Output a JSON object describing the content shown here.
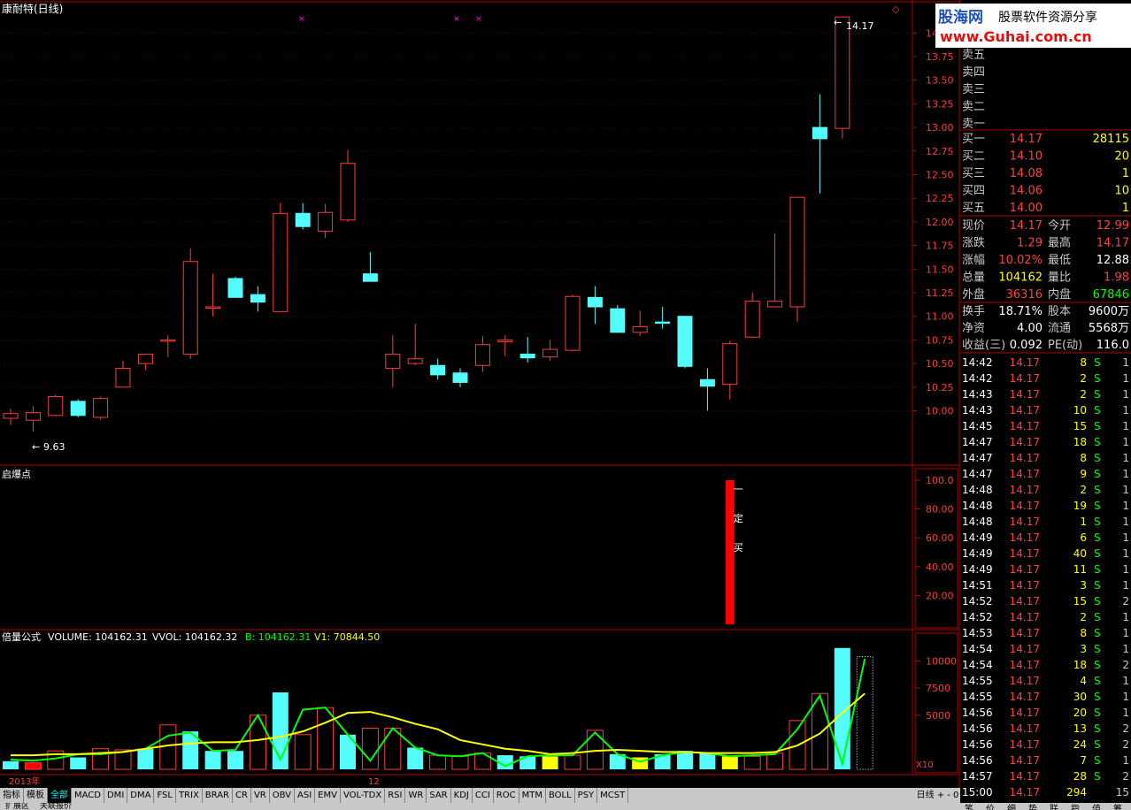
{
  "title": "康耐特(日线)",
  "top_icon": "◇",
  "watermark": {
    "line1": "股海网",
    "line2": "股票软件资源分享",
    "line3": "www.Guhai.com.cn"
  },
  "price_chart": {
    "high_label": "14.17",
    "low_label": "9.63",
    "y_ticks": [
      "10.00",
      "10.25",
      "10.50",
      "10.75",
      "11.00",
      "11.25",
      "11.50",
      "11.75",
      "12.00",
      "12.25",
      "12.50",
      "12.75",
      "13.00",
      "13.25",
      "13.50",
      "13.75",
      "14.00"
    ],
    "candles": [
      {
        "o": 9.92,
        "c": 9.97,
        "h": 10.02,
        "l": 9.85
      },
      {
        "o": 9.9,
        "c": 9.98,
        "h": 10.05,
        "l": 9.78
      },
      {
        "o": 9.95,
        "c": 10.15,
        "h": 10.17,
        "l": 9.94
      },
      {
        "o": 10.1,
        "c": 9.95,
        "h": 10.12,
        "l": 9.93
      },
      {
        "o": 9.93,
        "c": 10.13,
        "h": 10.15,
        "l": 9.91
      },
      {
        "o": 10.25,
        "c": 10.45,
        "h": 10.53,
        "l": 10.25
      },
      {
        "o": 10.5,
        "c": 10.6,
        "h": 10.6,
        "l": 10.43
      },
      {
        "o": 10.75,
        "c": 10.75,
        "h": 10.8,
        "l": 10.57
      },
      {
        "o": 10.6,
        "c": 11.58,
        "h": 11.72,
        "l": 10.55
      },
      {
        "o": 11.1,
        "c": 11.1,
        "h": 11.45,
        "l": 11.0
      },
      {
        "o": 11.4,
        "c": 11.2,
        "h": 11.42,
        "l": 11.2
      },
      {
        "o": 11.23,
        "c": 11.15,
        "h": 11.32,
        "l": 11.05
      },
      {
        "o": 11.05,
        "c": 12.09,
        "h": 12.2,
        "l": 11.05
      },
      {
        "o": 12.09,
        "c": 11.95,
        "h": 12.2,
        "l": 11.92
      },
      {
        "o": 11.9,
        "c": 12.1,
        "h": 12.19,
        "l": 11.83
      },
      {
        "o": 12.02,
        "c": 12.62,
        "h": 12.76,
        "l": 12.0
      },
      {
        "o": 11.45,
        "c": 11.37,
        "h": 11.68,
        "l": 11.37
      },
      {
        "o": 10.45,
        "c": 10.6,
        "h": 10.8,
        "l": 10.25
      },
      {
        "o": 10.5,
        "c": 10.55,
        "h": 10.92,
        "l": 10.48
      },
      {
        "o": 10.48,
        "c": 10.38,
        "h": 10.55,
        "l": 10.33
      },
      {
        "o": 10.4,
        "c": 10.3,
        "h": 10.45,
        "l": 10.25
      },
      {
        "o": 10.48,
        "c": 10.7,
        "h": 10.79,
        "l": 10.41
      },
      {
        "o": 10.73,
        "c": 10.75,
        "h": 10.8,
        "l": 10.58
      },
      {
        "o": 10.6,
        "c": 10.56,
        "h": 10.78,
        "l": 10.51
      },
      {
        "o": 10.57,
        "c": 10.65,
        "h": 10.75,
        "l": 10.53
      },
      {
        "o": 10.64,
        "c": 11.21,
        "h": 11.23,
        "l": 10.63
      },
      {
        "o": 11.2,
        "c": 11.1,
        "h": 11.32,
        "l": 10.92
      },
      {
        "o": 11.08,
        "c": 10.83,
        "h": 11.12,
        "l": 10.83
      },
      {
        "o": 10.83,
        "c": 10.89,
        "h": 11.06,
        "l": 10.79
      },
      {
        "o": 10.94,
        "c": 10.93,
        "h": 11.1,
        "l": 10.87
      },
      {
        "o": 11.0,
        "c": 10.47,
        "h": 11.0,
        "l": 10.45
      },
      {
        "o": 10.33,
        "c": 10.26,
        "h": 10.45,
        "l": 10.0
      },
      {
        "o": 10.28,
        "c": 10.71,
        "h": 10.74,
        "l": 10.12
      },
      {
        "o": 10.78,
        "c": 11.16,
        "h": 11.25,
        "l": 10.77
      },
      {
        "o": 11.1,
        "c": 11.16,
        "h": 11.88,
        "l": 11.1
      },
      {
        "o": 11.1,
        "c": 12.26,
        "h": 12.26,
        "l": 10.94
      },
      {
        "o": 13.0,
        "c": 12.88,
        "h": 13.35,
        "l": 12.3
      },
      {
        "o": 12.99,
        "c": 14.17,
        "h": 14.17,
        "l": 12.88
      }
    ]
  },
  "indicator": {
    "label": "启爆点",
    "y_ticks": [
      "20.00",
      "40.00",
      "60.00",
      "80.00",
      "100.0"
    ],
    "signal_text": [
      "一",
      "定",
      "买"
    ],
    "signal_value": 100
  },
  "volume": {
    "formula_name": "倍量公式",
    "volume_text": "VOLUME: 104162.31",
    "vvol_text": "VVOL: 104162.32",
    "b_text": "B: 104162.31",
    "v1_text": "V1: 70844.50",
    "y_ticks": [
      "5000",
      "7500",
      "10000"
    ],
    "x10": "X10",
    "bars": [
      750,
      600,
      1700,
      1100,
      1900,
      1800,
      1900,
      4100,
      3500,
      1700,
      1700,
      5000,
      7100,
      3200,
      5700,
      3200,
      3800,
      3800,
      2000,
      1300,
      1200,
      1500,
      1300,
      1200,
      1200,
      1300,
      3600,
      1400,
      1100,
      1400,
      1700,
      1500,
      1200,
      1200,
      1500,
      4500,
      7000,
      11200,
      10400
    ],
    "bar_types": [
      "c",
      "r",
      "r",
      "c",
      "r",
      "r",
      "c",
      "r",
      "c",
      "c",
      "c",
      "r",
      "c",
      "r",
      "r",
      "c",
      "r",
      "r",
      "c",
      "r",
      "r",
      "r",
      "c",
      "c",
      "y",
      "r",
      "r",
      "c",
      "y",
      "c",
      "c",
      "c",
      "y",
      "r",
      "r",
      "r",
      "r",
      "c",
      "d"
    ],
    "ma_yellow": [
      1300,
      1300,
      1400,
      1400,
      1500,
      1600,
      1900,
      2200,
      2400,
      2500,
      2500,
      2700,
      3000,
      3500,
      4300,
      5200,
      5300,
      4800,
      4200,
      3700,
      2700,
      2300,
      1900,
      1700,
      1400,
      1500,
      1700,
      1800,
      1700,
      1600,
      1600,
      1500,
      1500,
      1500,
      1600,
      2200,
      3300,
      5200,
      7000
    ],
    "ma_green": [
      900,
      800,
      1000,
      1400,
      1400,
      1600,
      1900,
      3100,
      3400,
      1700,
      1800,
      5000,
      900,
      5500,
      5700,
      3200,
      800,
      3800,
      2000,
      1300,
      1200,
      1500,
      300,
      1200,
      1300,
      1300,
      3400,
      1400,
      700,
      1300,
      1600,
      1500,
      1200,
      1300,
      1400,
      3700,
      6800,
      500,
      10200
    ]
  },
  "x_labels": {
    "label1": "2013年",
    "label2": "12"
  },
  "toolbar": {
    "tabs": [
      "指标",
      "模板",
      "全部",
      "MACD",
      "DMI",
      "DMA",
      "FSL",
      "TRIX",
      "BRAR",
      "CR",
      "VR",
      "OBV",
      "ASI",
      "EMV",
      "VOL-TDX",
      "RSI",
      "WR",
      "SAR",
      "KDJ",
      "CCI",
      "ROC",
      "MTM",
      "BOLL",
      "PSY",
      "MCST"
    ],
    "bottom_tabs": [
      "扩展区",
      "关联报价"
    ],
    "right_label": "日线",
    "right_buttons": [
      "+",
      "-",
      "0"
    ]
  },
  "quote": {
    "asks": [
      "卖五",
      "卖四",
      "卖三",
      "卖二",
      "卖一"
    ],
    "bids": [
      {
        "label": "买一",
        "price": "14.17",
        "vol": "28115"
      },
      {
        "label": "买二",
        "price": "14.10",
        "vol": "20"
      },
      {
        "label": "买三",
        "price": "14.08",
        "vol": "1"
      },
      {
        "label": "买四",
        "price": "14.06",
        "vol": "10"
      },
      {
        "label": "买五",
        "price": "14.00",
        "vol": "1"
      }
    ],
    "stats": [
      {
        "l1": "现价",
        "v1": "14.17",
        "l2": "今开",
        "v2": "12.99",
        "c1": "#ff4040",
        "c2": "#ff4040"
      },
      {
        "l1": "涨跌",
        "v1": "1.29",
        "l2": "最高",
        "v2": "14.17",
        "c1": "#ff4040",
        "c2": "#ff4040"
      },
      {
        "l1": "涨幅",
        "v1": "10.02%",
        "l2": "最低",
        "v2": "12.88",
        "c1": "#ff4040",
        "c2": "#ffffff"
      },
      {
        "l1": "总量",
        "v1": "104162",
        "l2": "量比",
        "v2": "1.98",
        "c1": "#ffff00",
        "c2": "#ff4040"
      },
      {
        "l1": "外盘",
        "v1": "36316",
        "l2": "内盘",
        "v2": "67846",
        "c1": "#ff4040",
        "c2": "#00ff00"
      }
    ],
    "stats2": [
      {
        "l1": "换手",
        "v1": "18.71%",
        "l2": "股本",
        "v2": "9600万"
      },
      {
        "l1": "净资",
        "v1": "4.00",
        "l2": "流通",
        "v2": "5568万"
      },
      {
        "l1": "收益(三)",
        "v1": "0.092",
        "l2": "PE(动)",
        "v2": "116.0"
      }
    ],
    "ticks": [
      {
        "t": "14:42",
        "p": "14.17",
        "v": "8",
        "s": "S",
        "n": "1"
      },
      {
        "t": "14:42",
        "p": "14.17",
        "v": "2",
        "s": "S",
        "n": "1"
      },
      {
        "t": "14:43",
        "p": "14.17",
        "v": "2",
        "s": "S",
        "n": "1"
      },
      {
        "t": "14:43",
        "p": "14.17",
        "v": "10",
        "s": "S",
        "n": "1"
      },
      {
        "t": "14:45",
        "p": "14.17",
        "v": "15",
        "s": "S",
        "n": "1"
      },
      {
        "t": "14:47",
        "p": "14.17",
        "v": "18",
        "s": "S",
        "n": "1"
      },
      {
        "t": "14:47",
        "p": "14.17",
        "v": "8",
        "s": "S",
        "n": "1"
      },
      {
        "t": "14:47",
        "p": "14.17",
        "v": "9",
        "s": "S",
        "n": "1"
      },
      {
        "t": "14:48",
        "p": "14.17",
        "v": "2",
        "s": "S",
        "n": "1"
      },
      {
        "t": "14:48",
        "p": "14.17",
        "v": "19",
        "s": "S",
        "n": "1"
      },
      {
        "t": "14:48",
        "p": "14.17",
        "v": "1",
        "s": "S",
        "n": "1"
      },
      {
        "t": "14:49",
        "p": "14.17",
        "v": "6",
        "s": "S",
        "n": "1"
      },
      {
        "t": "14:49",
        "p": "14.17",
        "v": "40",
        "s": "S",
        "n": "1"
      },
      {
        "t": "14:49",
        "p": "14.17",
        "v": "11",
        "s": "S",
        "n": "1"
      },
      {
        "t": "14:51",
        "p": "14.17",
        "v": "3",
        "s": "S",
        "n": "1"
      },
      {
        "t": "14:52",
        "p": "14.17",
        "v": "15",
        "s": "S",
        "n": "2"
      },
      {
        "t": "14:52",
        "p": "14.17",
        "v": "2",
        "s": "S",
        "n": "1"
      },
      {
        "t": "14:53",
        "p": "14.17",
        "v": "8",
        "s": "S",
        "n": "1"
      },
      {
        "t": "14:54",
        "p": "14.17",
        "v": "3",
        "s": "S",
        "n": "1"
      },
      {
        "t": "14:54",
        "p": "14.17",
        "v": "18",
        "s": "S",
        "n": "2"
      },
      {
        "t": "14:55",
        "p": "14.17",
        "v": "4",
        "s": "S",
        "n": "1"
      },
      {
        "t": "14:55",
        "p": "14.17",
        "v": "30",
        "s": "S",
        "n": "1"
      },
      {
        "t": "14:56",
        "p": "14.17",
        "v": "20",
        "s": "S",
        "n": "1"
      },
      {
        "t": "14:56",
        "p": "14.17",
        "v": "13",
        "s": "S",
        "n": "2"
      },
      {
        "t": "14:56",
        "p": "14.17",
        "v": "24",
        "s": "S",
        "n": "2"
      },
      {
        "t": "14:56",
        "p": "14.17",
        "v": "7",
        "s": "S",
        "n": "1"
      },
      {
        "t": "14:57",
        "p": "14.17",
        "v": "28",
        "s": "S",
        "n": "2"
      },
      {
        "t": "15:00",
        "p": "14.17",
        "v": "294",
        "s": "",
        "n": "15"
      }
    ],
    "bottom_tabs": [
      "笔",
      "价",
      "细",
      "势",
      "联",
      "指",
      "值",
      "筹"
    ]
  },
  "colors": {
    "up": "#ff3c3c",
    "down": "#54fcfc",
    "axis": "#b00000",
    "grid": "#5a0000",
    "yellow": "#ffff00",
    "green": "#00ff00",
    "white": "#ffffff"
  }
}
